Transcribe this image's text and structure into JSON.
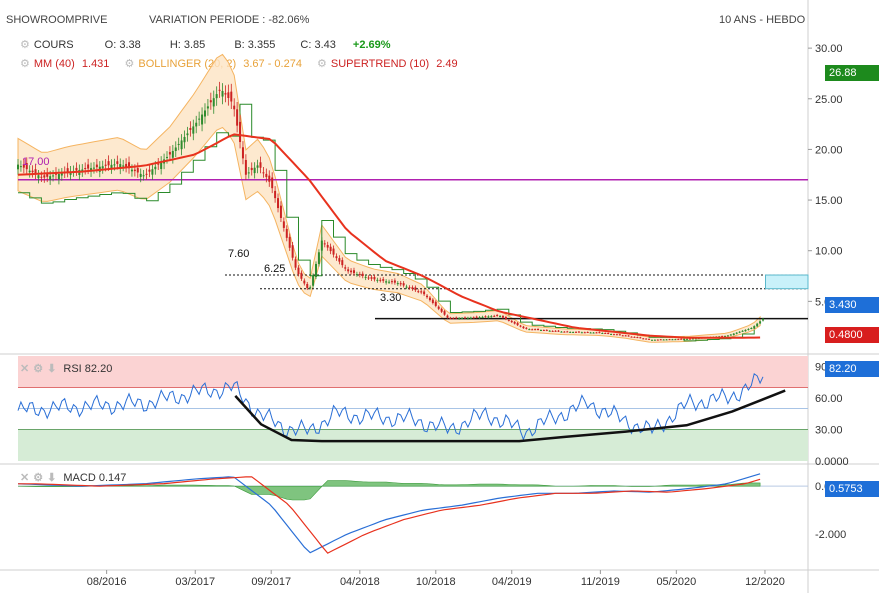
{
  "header": {
    "symbol": "SHOWROOMPRIVE",
    "variation": "VARIATION PERIODE : -82.06%",
    "period": "10 ANS - HEBDO"
  },
  "legend": {
    "row1": {
      "label": "COURS",
      "o": "O: 3.38",
      "h": "H: 3.85",
      "b": "B: 3.355",
      "c": "C: 3.43",
      "chg": "+2.69%"
    },
    "row2": {
      "mm": "MM (40)",
      "mm_val": "1.431",
      "boll": "BOLLINGER (20, 2)",
      "boll_val": "3.67 - 0.274",
      "st": "SUPERTREND (10)",
      "st_val": "2.49"
    }
  },
  "annotations": {
    "l760": "7.60",
    "l625": "6.25",
    "l330": "3.30",
    "l1700": "17.00"
  },
  "badges": {
    "price_top": "26.88",
    "price_cur": "3.430",
    "price_low": "0.4800",
    "rsi": "82.20",
    "macd": "0.5753"
  },
  "rsi_title": {
    "label": "RSI",
    "value": "82.20"
  },
  "macd_title": {
    "label": "MACD",
    "value": "0.147"
  },
  "colors": {
    "up": "#2e8b2e",
    "down": "#cc2222",
    "mm": "#e8321e",
    "boll": "#f5b461",
    "supertrend_up": "#2a8a2a",
    "supertrend_down": "#b01818",
    "rsi": "#2a6fd6",
    "macd": "#2a6fd6",
    "signal": "#e8321e",
    "hist": "#3c9a3c",
    "magenta": "#b020b0"
  },
  "chart_data": {
    "type": "line",
    "title": "SHOWROOMPRIVE",
    "x_ticks": [
      "08/2016",
      "03/2017",
      "09/2017",
      "04/2018",
      "10/2018",
      "04/2019",
      "11/2019",
      "05/2020",
      "12/2020"
    ],
    "price_axis": {
      "ticks": [
        "30.00",
        "25.00",
        "20.00",
        "15.00",
        "10.00",
        "5.00"
      ],
      "range": [
        0,
        30
      ]
    },
    "rsi_axis": {
      "ticks": [
        "90.00",
        "60.00",
        "30.00",
        "0.0000"
      ],
      "range": [
        0,
        100
      ]
    },
    "macd_axis": {
      "ticks": [
        "0.000",
        "-2.000"
      ],
      "range": [
        -3.5,
        0.8
      ]
    },
    "close_series": [
      [
        "2016-01",
        18.5
      ],
      [
        "2016-03",
        17.2
      ],
      [
        "2016-05",
        17.8
      ],
      [
        "2016-07",
        18.2
      ],
      [
        "2016-09",
        18.6
      ],
      [
        "2016-11",
        17.4
      ],
      [
        "2017-01",
        19.5
      ],
      [
        "2017-03",
        22.5
      ],
      [
        "2017-05",
        26.0
      ],
      [
        "2017-06",
        24.5
      ],
      [
        "2017-07",
        17.5
      ],
      [
        "2017-08",
        18.5
      ],
      [
        "2017-09",
        16.5
      ],
      [
        "2017-11",
        8.0
      ],
      [
        "2017-12",
        6.0
      ],
      [
        "2018-01",
        11.0
      ],
      [
        "2018-03",
        8.0
      ],
      [
        "2018-05",
        7.2
      ],
      [
        "2018-07",
        6.8
      ],
      [
        "2018-09",
        5.8
      ],
      [
        "2018-11",
        3.3
      ],
      [
        "2019-01",
        3.4
      ],
      [
        "2019-03",
        3.6
      ],
      [
        "2019-05",
        2.3
      ],
      [
        "2019-08",
        2.0
      ],
      [
        "2019-11",
        1.9
      ],
      [
        "2020-01",
        1.6
      ],
      [
        "2020-03",
        1.2
      ],
      [
        "2020-06",
        1.3
      ],
      [
        "2020-09",
        1.6
      ],
      [
        "2020-11",
        2.4
      ],
      [
        "2020-12",
        3.43
      ]
    ],
    "ma40_series": [
      [
        "2016-01",
        17.5
      ],
      [
        "2016-06",
        17.8
      ],
      [
        "2016-11",
        18.4
      ],
      [
        "2017-03",
        19.5
      ],
      [
        "2017-06",
        21.5
      ],
      [
        "2017-09",
        21.0
      ],
      [
        "2017-12",
        17.0
      ],
      [
        "2018-03",
        12.0
      ],
      [
        "2018-06",
        9.0
      ],
      [
        "2018-09",
        7.5
      ],
      [
        "2018-12",
        5.5
      ],
      [
        "2019-03",
        4.0
      ],
      [
        "2019-06",
        3.2
      ],
      [
        "2019-09",
        2.4
      ],
      [
        "2019-12",
        2.0
      ],
      [
        "2020-03",
        1.6
      ],
      [
        "2020-06",
        1.4
      ],
      [
        "2020-09",
        1.4
      ],
      [
        "2020-12",
        1.431
      ]
    ],
    "rsi_series": [
      [
        "2016-01",
        48
      ],
      [
        "2016-06",
        52
      ],
      [
        "2016-11",
        55
      ],
      [
        "2017-03",
        65
      ],
      [
        "2017-06",
        70
      ],
      [
        "2017-08",
        45
      ],
      [
        "2017-10",
        32
      ],
      [
        "2017-12",
        28
      ],
      [
        "2018-02",
        45
      ],
      [
        "2018-05",
        42
      ],
      [
        "2018-08",
        40
      ],
      [
        "2018-11",
        30
      ],
      [
        "2019-02",
        45
      ],
      [
        "2019-05",
        28
      ],
      [
        "2019-08",
        45
      ],
      [
        "2019-10",
        55
      ],
      [
        "2020-01",
        38
      ],
      [
        "2020-03",
        28
      ],
      [
        "2020-06",
        55
      ],
      [
        "2020-09",
        60
      ],
      [
        "2020-11",
        72
      ],
      [
        "2020-12",
        82.2
      ]
    ],
    "macd_series": [
      [
        "2016-01",
        0.1
      ],
      [
        "2016-06",
        0.0
      ],
      [
        "2016-11",
        0.1
      ],
      [
        "2017-03",
        0.3
      ],
      [
        "2017-06",
        0.4
      ],
      [
        "2017-09",
        -0.8
      ],
      [
        "2017-12",
        -2.8
      ],
      [
        "2018-03",
        -2.0
      ],
      [
        "2018-06",
        -1.4
      ],
      [
        "2018-09",
        -1.0
      ],
      [
        "2018-12",
        -0.8
      ],
      [
        "2019-03",
        -0.5
      ],
      [
        "2019-06",
        -0.3
      ],
      [
        "2019-09",
        -0.3
      ],
      [
        "2019-12",
        -0.2
      ],
      [
        "2020-03",
        -0.25
      ],
      [
        "2020-06",
        -0.1
      ],
      [
        "2020-09",
        0.1
      ],
      [
        "2020-12",
        0.5753
      ]
    ],
    "horizontal_levels": [
      17.0,
      7.6,
      6.25,
      3.3
    ]
  }
}
